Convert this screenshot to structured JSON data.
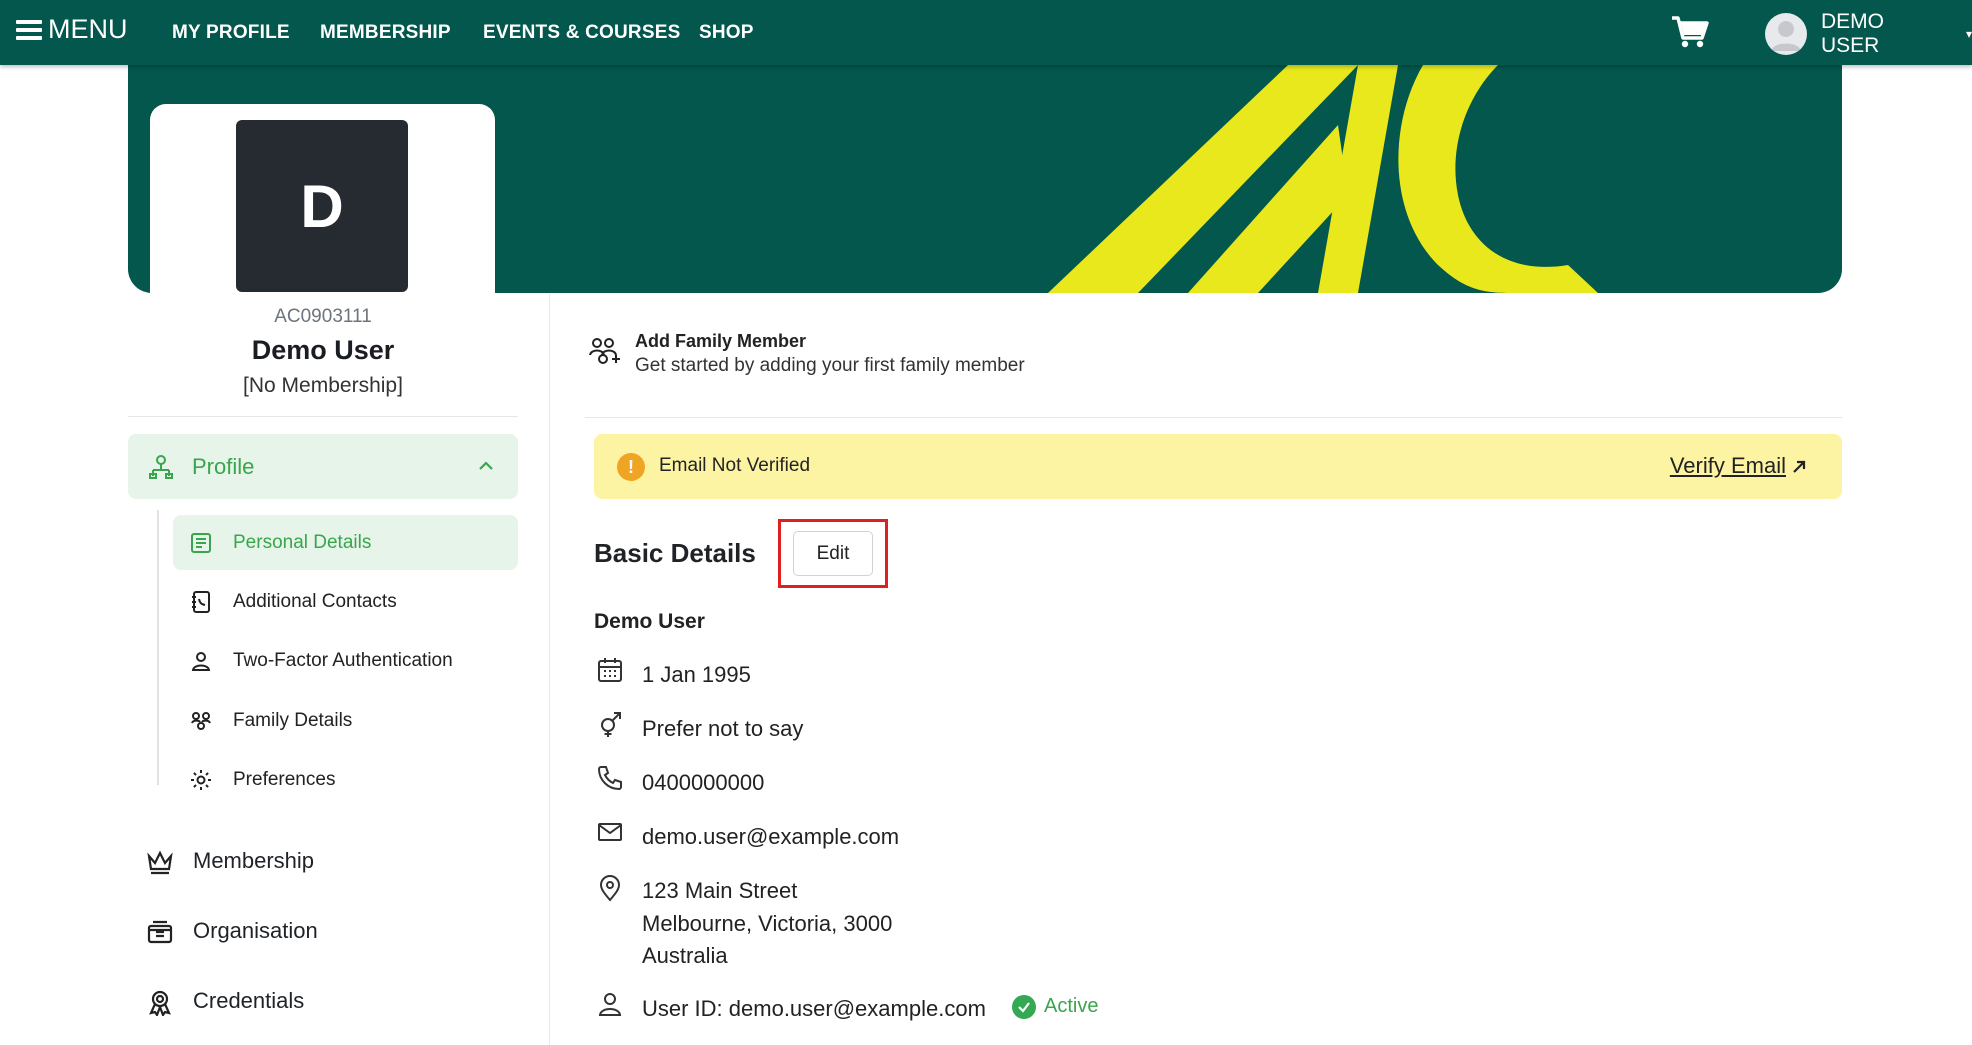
{
  "topbar": {
    "menu_label": "MENU",
    "nav": [
      "MY PROFILE",
      "MEMBERSHIP",
      "EVENTS & COURSES",
      "SHOP"
    ],
    "user_label": "DEMO USER",
    "cart_icon": "cart-icon"
  },
  "colors": {
    "header_bg": "#03574d",
    "accent_yellow": "#e8e81c",
    "accent_green": "#3aa54c",
    "alert_bg": "#fdf4a3"
  },
  "profile": {
    "initial": "D",
    "id": "AC0903111",
    "name": "Demo User",
    "membership_status": "[No Membership]"
  },
  "sidebar": {
    "group_label": "Profile",
    "subitems": [
      "Personal Details",
      "Additional Contacts",
      "Two-Factor Authentication",
      "Family Details",
      "Preferences"
    ],
    "main_items": [
      "Membership",
      "Organisation",
      "Credentials"
    ]
  },
  "family": {
    "title": "Add Family Member",
    "subtitle": "Get started by adding your first family member"
  },
  "alert": {
    "text": "Email Not Verified",
    "action": "Verify Email"
  },
  "basic": {
    "title": "Basic Details",
    "edit_label": "Edit",
    "name": "Demo User",
    "dob": "1 Jan 1995",
    "gender": "Prefer not to say",
    "phone": "0400000000",
    "email": "demo.user@example.com",
    "address": [
      "123 Main Street",
      "Melbourne, Victoria, 3000",
      "Australia"
    ],
    "user_id": "User ID: demo.user@example.com",
    "status": "Active"
  }
}
